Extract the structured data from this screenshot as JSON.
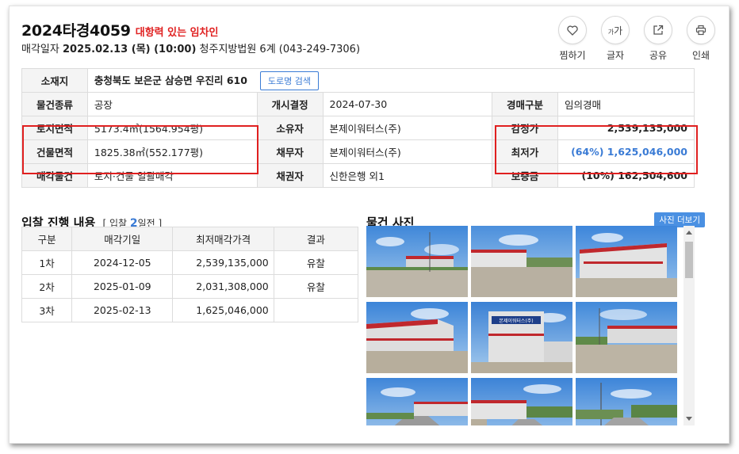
{
  "header": {
    "case_number": "2024타경4059",
    "badge": "대항력 있는 임차인",
    "sale_date_label": "매각일자",
    "sale_date": "2025.02.13 (목) (10:00)",
    "court": "청주지방법원 6계 (043-249-7306)"
  },
  "actions": [
    {
      "icon": "heart-icon",
      "label": "찜하기"
    },
    {
      "icon": "font-size-icon",
      "label": "글자"
    },
    {
      "icon": "share-icon",
      "label": "공유"
    },
    {
      "icon": "print-icon",
      "label": "인쇄"
    }
  ],
  "info": {
    "address_label": "소재지",
    "address": "충청북도 보은군 삼승면 우진리 610",
    "road_button": "도로명 검색",
    "type_label": "물건종류",
    "type": "공장",
    "start_label": "개시결정",
    "start": "2024-07-30",
    "kind_label": "경매구분",
    "kind": "임의경매",
    "land_label": "토지면적",
    "land": "5173.4㎡(1564.954평)",
    "owner_label": "소유자",
    "owner": "본제이워터스(주)",
    "appraisal_label": "감정가",
    "appraisal": "2,539,135,000",
    "building_label": "건물면적",
    "building": "1825.38㎡(552.177평)",
    "debtor_label": "채무자",
    "debtor": "본제이워터스(주)",
    "min_label": "최저가",
    "min": "(64%) 1,625,046,000",
    "sale_item_label": "매각물건",
    "sale_item": "토지·건물 일괄매각",
    "creditor_label": "채권자",
    "creditor": "신한은행 외1",
    "deposit_label": "보증금",
    "deposit": "(10%) 162,504,600"
  },
  "bidding": {
    "title": "입찰 진행 내용",
    "sub_prefix": "[ 입찰",
    "days": "2",
    "sub_suffix": "일전 ]",
    "headers": [
      "구분",
      "매각기일",
      "최저매각가격",
      "결과"
    ],
    "rows": [
      {
        "round": "1차",
        "date": "2024-12-05",
        "price": "2,539,135,000",
        "result": "유찰"
      },
      {
        "round": "2차",
        "date": "2025-01-09",
        "price": "2,031,308,000",
        "result": "유찰"
      },
      {
        "round": "3차",
        "date": "2025-02-13",
        "price": "1,625,046,000",
        "result": ""
      }
    ]
  },
  "photos": {
    "title": "물건 사진",
    "more": "사진 더보기",
    "sign_text": "본제이워터스(주)"
  },
  "colors": {
    "accent": "#3a7bd5",
    "highlight_red": "#e02020",
    "header_bg": "#f4f4f4"
  }
}
